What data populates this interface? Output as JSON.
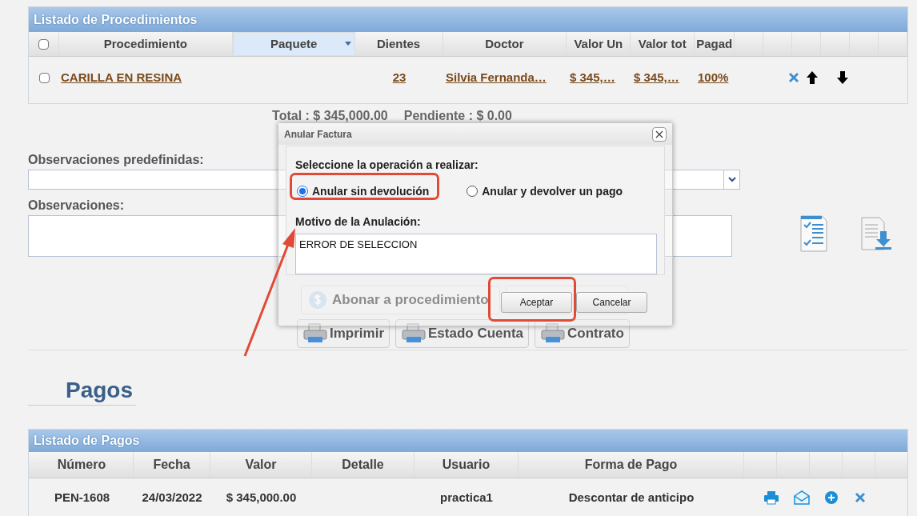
{
  "procedures": {
    "title": "Listado de Procedimientos",
    "select_all": {
      "checked": false
    },
    "columns": [
      {
        "label": "Procedimiento",
        "active": false
      },
      {
        "label": "Paquete",
        "active": true
      },
      {
        "label": "Dientes",
        "active": false
      },
      {
        "label": "Doctor",
        "active": false
      },
      {
        "label": "Valor Un",
        "active": false
      },
      {
        "label": "Valor tot",
        "active": false
      },
      {
        "label": "Pagad",
        "active": false
      }
    ],
    "rows": [
      {
        "checked": false,
        "cells": [
          "CARILLA EN RESINA",
          "",
          "23",
          "Silvia Fernanda…",
          "$ 345,…",
          "$ 345,…",
          "100%"
        ]
      }
    ]
  },
  "totals": [
    "Total : $ 345,000.00",
    "Pendiente : $ 0.00"
  ],
  "form": {
    "predefined_label": "Observaciones predefinidas:",
    "observations_label": "Observaciones:"
  },
  "actions": [
    {
      "label": "Abonar a procedimiento"
    },
    {
      "label": "Imprimir"
    },
    {
      "label": "Estado Cuenta"
    },
    {
      "label": "Contrato"
    }
  ],
  "payments": {
    "heading": "Pagos",
    "title": "Listado de Pagos",
    "columns": [
      "Número",
      "Fecha",
      "Valor",
      "Detalle",
      "Usuario",
      "Forma de Pago"
    ],
    "rows": [
      [
        "PEN-1608",
        "24/03/2022",
        "$ 345,000.00",
        "",
        "practica1",
        "Descontar de anticipo"
      ]
    ]
  },
  "dialog": {
    "title": "Anular Factura",
    "prompt": "Seleccione la operación a realizar:",
    "options": [
      {
        "label": "Anular sin devolución",
        "selected": true
      },
      {
        "label": "Anular y devolver un pago",
        "selected": false
      }
    ],
    "reason_label": "Motivo de la Anulación:",
    "reason_value": "ERROR DE SELECCION",
    "buttons": [
      "Aceptar",
      "Cancelar"
    ]
  }
}
